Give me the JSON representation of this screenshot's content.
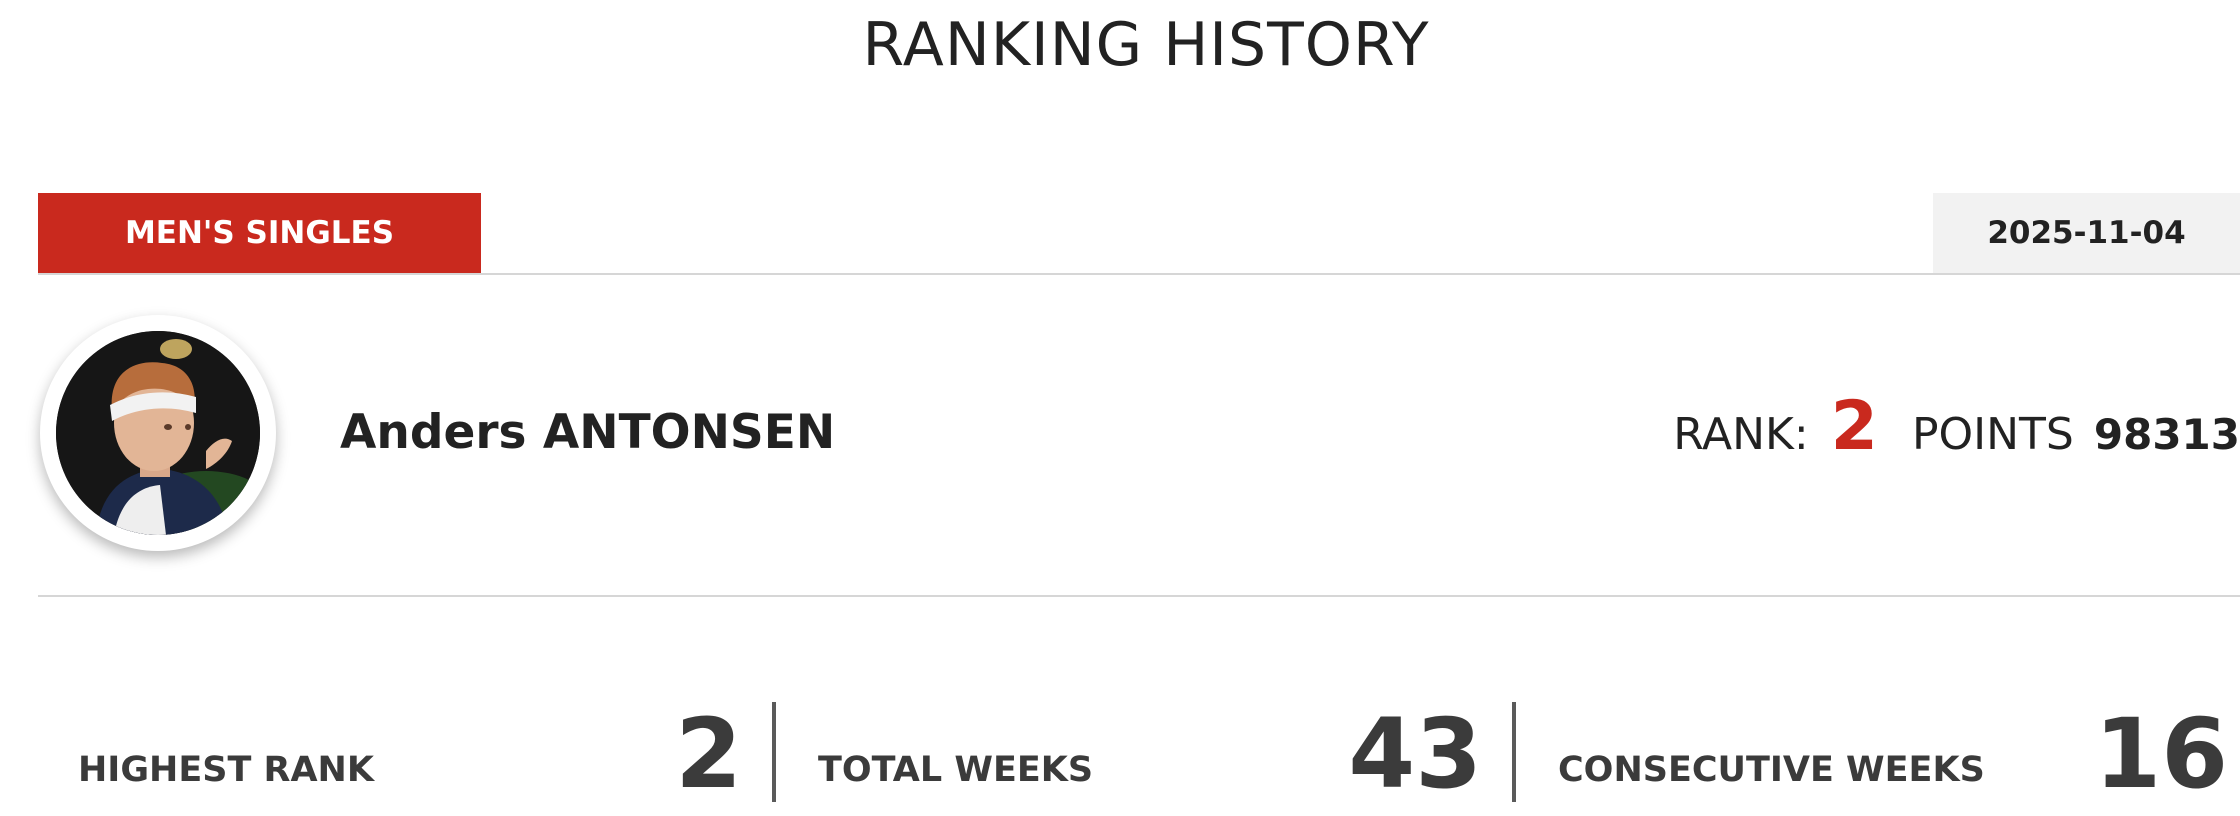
{
  "page": {
    "title": "RANKING HISTORY"
  },
  "tabs": {
    "category_label": "MEN'S SINGLES",
    "date": "2025-11-04"
  },
  "player": {
    "name": "Anders ANTONSEN",
    "rank_label": "RANK:",
    "rank": "2",
    "points_label": "POINTS",
    "points": "98313"
  },
  "stats": [
    {
      "label": "HIGHEST RANK",
      "value": "2"
    },
    {
      "label": "TOTAL WEEKS",
      "value": "43"
    },
    {
      "label": "CONSECUTIVE WEEKS",
      "value": "16"
    }
  ],
  "colors": {
    "accent": "#c9291e",
    "text": "#222222",
    "stat_text": "#3b3b3b",
    "date_bg": "#f2f2f2",
    "divider": "#d6d6d6"
  }
}
